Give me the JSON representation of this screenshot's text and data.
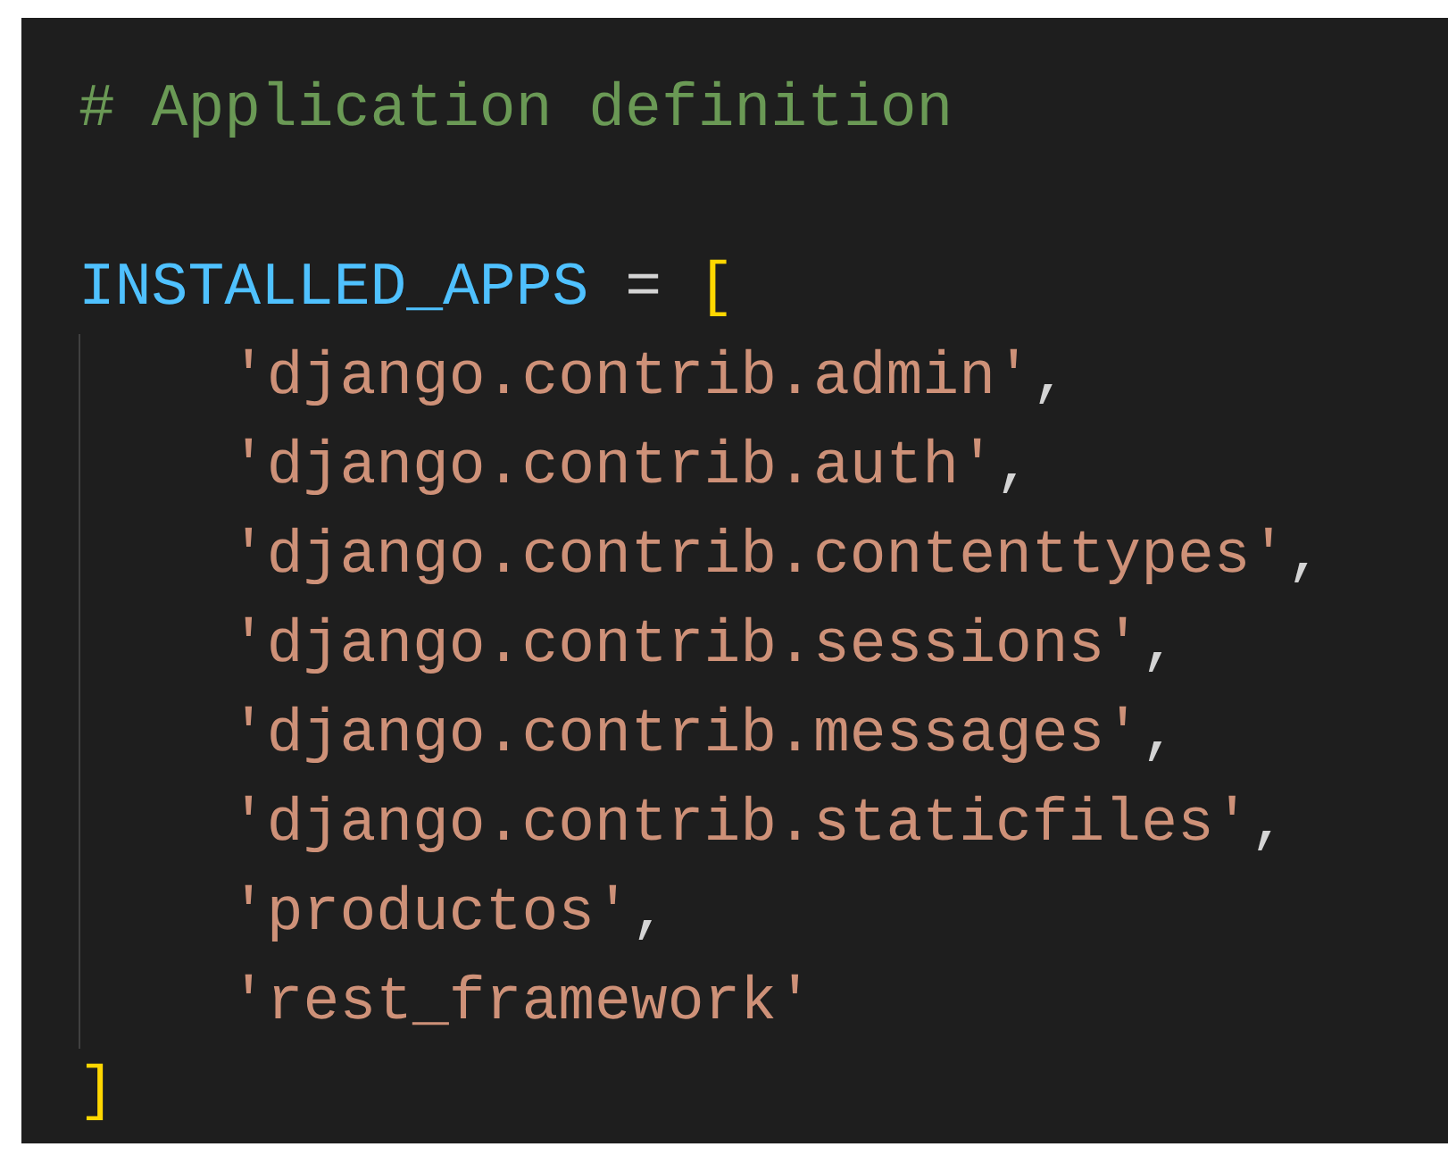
{
  "editor": {
    "comment": "# Application definition",
    "assignment": {
      "name": "INSTALLED_APPS",
      "operator": "=",
      "open_bracket": "[",
      "close_bracket": "]",
      "items": [
        {
          "value": "'django.contrib.admin'",
          "separator": ","
        },
        {
          "value": "'django.contrib.auth'",
          "separator": ","
        },
        {
          "value": "'django.contrib.contenttypes'",
          "separator": ","
        },
        {
          "value": "'django.contrib.sessions'",
          "separator": ","
        },
        {
          "value": "'django.contrib.messages'",
          "separator": ","
        },
        {
          "value": "'django.contrib.staticfiles'",
          "separator": ","
        },
        {
          "value": "'productos'",
          "separator": ","
        },
        {
          "value": "'rest_framework'"
        }
      ]
    }
  }
}
